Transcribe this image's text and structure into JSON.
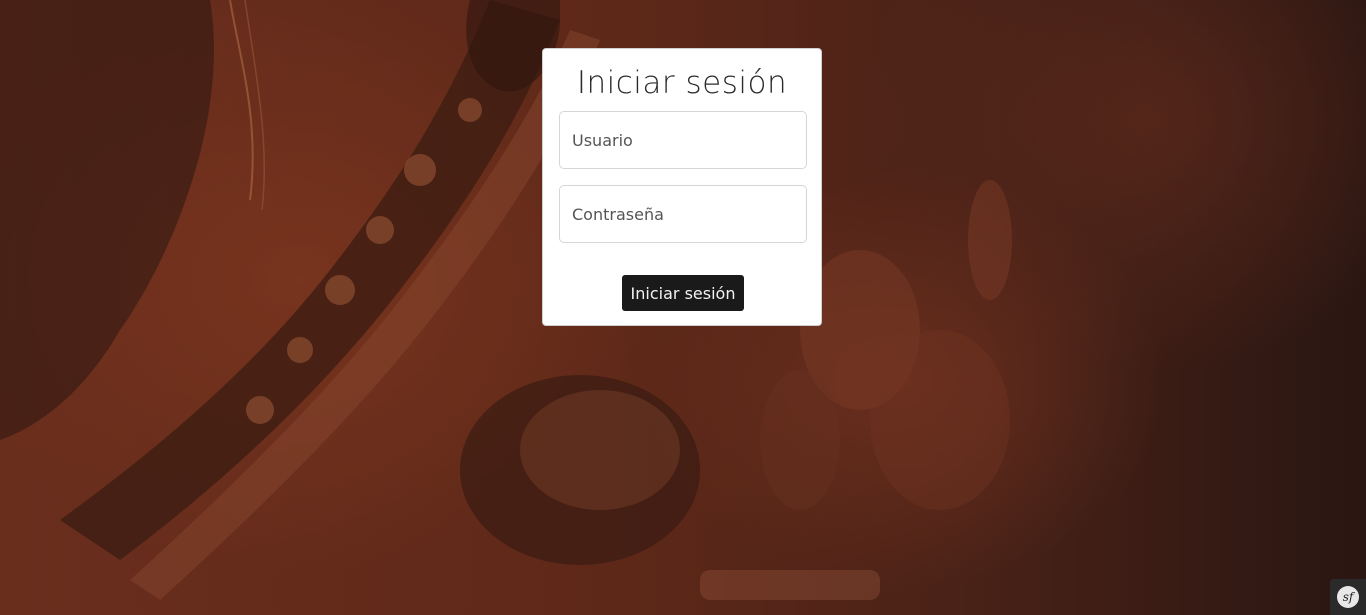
{
  "login": {
    "title": "Iniciar sesión",
    "username_placeholder": "Usuario",
    "password_placeholder": "Contraseña",
    "submit_label": "Iniciar sesión"
  },
  "debug_badge": {
    "logo_text": "sf"
  },
  "background": {
    "description_colors": {
      "tint": "#6a2e1d",
      "dark": "#2a1612"
    }
  }
}
